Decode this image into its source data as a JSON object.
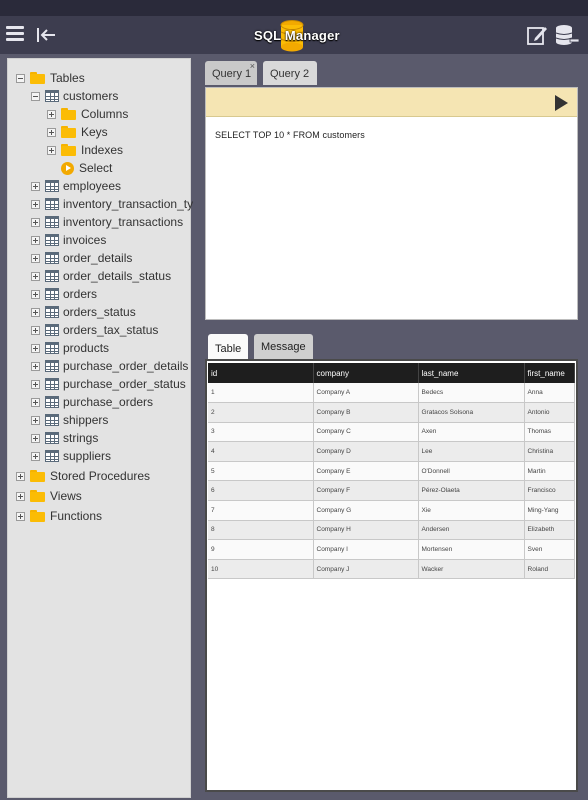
{
  "app": {
    "title": "SQL Manager"
  },
  "toolbar": {
    "menu_icon": "hamburger-menu-icon",
    "back_icon": "collapse-left-icon",
    "edit_icon": "edit-icon",
    "db_icon": "database-remove-icon"
  },
  "tree": {
    "tables_label": "Tables",
    "customers_label": "customers",
    "customer_children": [
      "Columns",
      "Keys",
      "Indexes",
      "Select"
    ],
    "tables": [
      "employees",
      "inventory_transaction_ty",
      "inventory_transactions",
      "invoices",
      "order_details",
      "order_details_status",
      "orders",
      "orders_status",
      "orders_tax_status",
      "products",
      "purchase_order_details",
      "purchase_order_status",
      "purchase_orders",
      "shippers",
      "strings",
      "suppliers"
    ],
    "other_folders": [
      "Stored Procedures",
      "Views",
      "Functions"
    ]
  },
  "query_tabs": [
    {
      "label": "Query 1",
      "close": "×"
    },
    {
      "label": "Query 2"
    }
  ],
  "editor": {
    "sql": "SELECT TOP 10 * FROM customers"
  },
  "result_tabs": [
    "Table",
    "Message"
  ],
  "results": {
    "columns": [
      "id",
      "company",
      "last_name",
      "first_name"
    ],
    "rows": [
      [
        "1",
        "Company A",
        "Bedecs",
        "Anna"
      ],
      [
        "2",
        "Company B",
        "Gratacos Solsona",
        "Antonio"
      ],
      [
        "3",
        "Company C",
        "Axen",
        "Thomas"
      ],
      [
        "4",
        "Company D",
        "Lee",
        "Christina"
      ],
      [
        "5",
        "Company E",
        "O'Donnell",
        "Martin"
      ],
      [
        "6",
        "Company F",
        "Pérez-Olaeta",
        "Francisco"
      ],
      [
        "7",
        "Company G",
        "Xie",
        "Ming-Yang"
      ],
      [
        "8",
        "Company H",
        "Andersen",
        "Elizabeth"
      ],
      [
        "9",
        "Company I",
        "Mortensen",
        "Sven"
      ],
      [
        "10",
        "Company J",
        "Wacker",
        "Roland"
      ]
    ]
  },
  "colors": {
    "accent": "#fbbc05",
    "appbar": "#3d3d4f",
    "editor_bar": "#f5e5b3"
  }
}
